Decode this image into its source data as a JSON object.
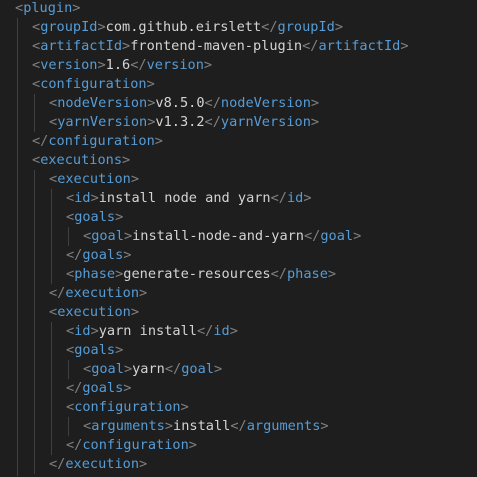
{
  "code_lines": [
    {
      "indent": 0,
      "open": "plugin",
      "text": "",
      "close": ""
    },
    {
      "indent": 1,
      "open": "groupId",
      "text": "com.github.eirslett",
      "close": "groupId"
    },
    {
      "indent": 1,
      "open": "artifactId",
      "text": "frontend-maven-plugin",
      "close": "artifactId"
    },
    {
      "indent": 1,
      "open": "version",
      "text": "1.6",
      "close": "version"
    },
    {
      "indent": 1,
      "open": "configuration",
      "text": "",
      "close": ""
    },
    {
      "indent": 2,
      "open": "nodeVersion",
      "text": "v8.5.0",
      "close": "nodeVersion"
    },
    {
      "indent": 2,
      "open": "yarnVersion",
      "text": "v1.3.2",
      "close": "yarnVersion"
    },
    {
      "indent": 1,
      "open": "",
      "text": "",
      "close": "configuration"
    },
    {
      "indent": 1,
      "open": "executions",
      "text": "",
      "close": ""
    },
    {
      "indent": 2,
      "open": "execution",
      "text": "",
      "close": ""
    },
    {
      "indent": 3,
      "open": "id",
      "text": "install node and yarn",
      "close": "id"
    },
    {
      "indent": 3,
      "open": "goals",
      "text": "",
      "close": ""
    },
    {
      "indent": 4,
      "open": "goal",
      "text": "install-node-and-yarn",
      "close": "goal"
    },
    {
      "indent": 3,
      "open": "",
      "text": "",
      "close": "goals"
    },
    {
      "indent": 3,
      "open": "phase",
      "text": "generate-resources",
      "close": "phase"
    },
    {
      "indent": 2,
      "open": "",
      "text": "",
      "close": "execution"
    },
    {
      "indent": 2,
      "open": "execution",
      "text": "",
      "close": ""
    },
    {
      "indent": 3,
      "open": "id",
      "text": "yarn install",
      "close": "id"
    },
    {
      "indent": 3,
      "open": "goals",
      "text": "",
      "close": ""
    },
    {
      "indent": 4,
      "open": "goal",
      "text": "yarn",
      "close": "goal"
    },
    {
      "indent": 3,
      "open": "",
      "text": "",
      "close": "goals"
    },
    {
      "indent": 3,
      "open": "configuration",
      "text": "",
      "close": ""
    },
    {
      "indent": 4,
      "open": "arguments",
      "text": "install",
      "close": "arguments"
    },
    {
      "indent": 3,
      "open": "",
      "text": "",
      "close": "configuration"
    },
    {
      "indent": 2,
      "open": "",
      "text": "",
      "close": "execution"
    }
  ],
  "colors": {
    "background": "#1e1e1e",
    "punctuation": "#808080",
    "tag": "#569cd6",
    "text": "#d4d4d4",
    "indent_guide": "#404040"
  }
}
